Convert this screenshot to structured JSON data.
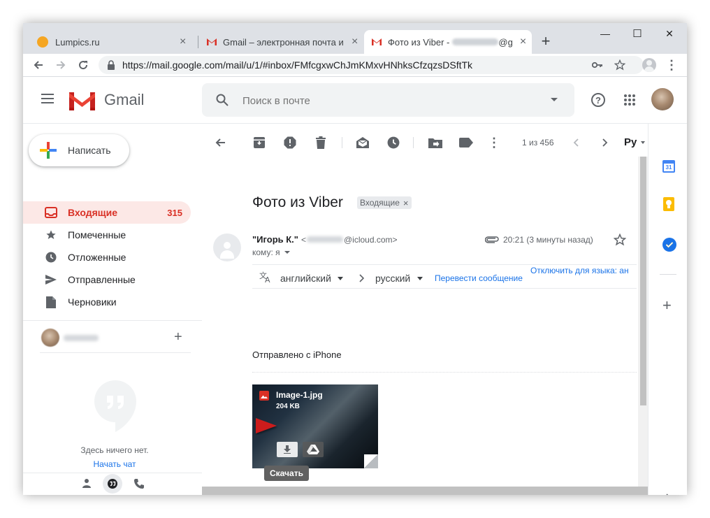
{
  "tabs": [
    {
      "title": "Lumpics.ru",
      "close": "×"
    },
    {
      "title": "Gmail – электронная почта и бе",
      "close": "×"
    },
    {
      "title": "Фото из Viber -",
      "close": "×",
      "tail": "@g"
    }
  ],
  "new_tab": "+",
  "window_controls": {
    "minimize": "—",
    "maximize": "☐",
    "close": "✕"
  },
  "address": {
    "url": "https://mail.google.com/mail/u/1/#inbox/FMfcgxwChJmKMxvHNhksCfzqzsDSftTk"
  },
  "gmail": {
    "app_name": "Gmail",
    "search_placeholder": "Поиск в почте"
  },
  "sidebar": {
    "compose_label": "Написать",
    "items": [
      {
        "label": "Входящие",
        "count": "315"
      },
      {
        "label": "Помеченные"
      },
      {
        "label": "Отложенные"
      },
      {
        "label": "Отправленные"
      },
      {
        "label": "Черновики"
      }
    ],
    "hangouts_empty": "Здесь ничего нет.",
    "start_chat": "Начать чат",
    "add": "+"
  },
  "toolbar": {
    "pagination": "1 из 456",
    "lang_button": "Ру"
  },
  "email": {
    "subject": "Фото из Viber",
    "label": "Входящие",
    "label_close": "×",
    "sender_name": "\"Игорь К.\"",
    "sender_email_open": "<",
    "sender_email_domain": "@icloud.com>",
    "recipient": "кому: я",
    "time": "20:21 (3 минуты назад)",
    "translate": {
      "from": "английский",
      "to": "русский",
      "translate_link": "Перевести сообщение",
      "disable_link": "Отключить для языка: ан"
    },
    "body": "Отправлено с iPhone",
    "attachment": {
      "name": "Image-1.jpg",
      "size": "204 KB",
      "tooltip": "Скачать"
    }
  },
  "colors": {
    "accent_red": "#d93025",
    "link_blue": "#1a73e8",
    "inbox_bg": "#fce8e6",
    "arrow_red": "#cc1f1f"
  }
}
